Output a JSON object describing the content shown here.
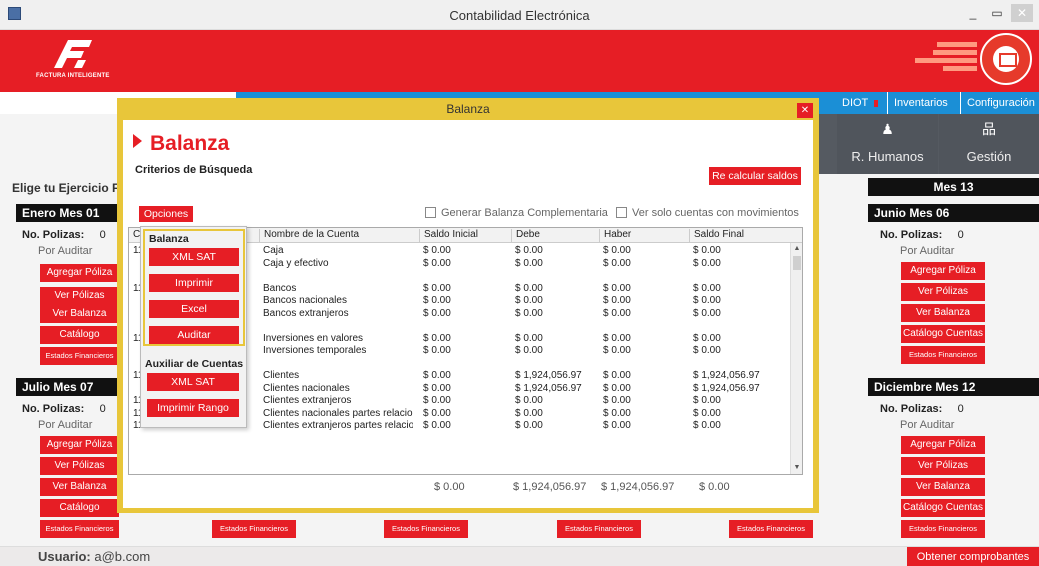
{
  "window": {
    "title": "Contabilidad Electrónica",
    "minimize": "_",
    "maximize": "▭",
    "close": "✕"
  },
  "brand": {
    "name": "FACTURA INTELIGENTE"
  },
  "nav": {
    "diot": "DIOT",
    "inventarios": "Inventarios",
    "configuracion": "Configuración"
  },
  "tiles": {
    "rhumanos": "R. Humanos",
    "gestion": "Gestión"
  },
  "dashboard": {
    "choose_year": "Elige tu Ejercicio F",
    "mes13": "Mes 13",
    "months": {
      "enero": "Enero Mes 01",
      "junio": "Junio Mes 06",
      "julio": "Julio Mes 07",
      "diciembre": "Diciembre Mes 12"
    },
    "polizas_label": "No. Polizas:",
    "polizas_count": "0",
    "por_auditar": "Por Auditar",
    "buttons": {
      "agregar": "Agregar Póliza",
      "ver_polizas": "Ver Pólizas",
      "ver_balanza": "Ver Balanza",
      "catalogo": "Catálogo Cuentas",
      "estados": "Estados Financieros"
    }
  },
  "statusbar": {
    "user_label": "Usuario:",
    "user": "a@b.com",
    "get_button": "Obtener comprobantes"
  },
  "modal": {
    "title": "Balanza",
    "heading": "Balanza",
    "criteria": "Criterios de Búsqueda",
    "recalc": "Re calcular saldos",
    "opciones": "Opciones",
    "complementaria": "Generar Balanza Complementaria",
    "solo_movimientos": "Ver solo cuentas con movimientos",
    "columns": [
      "C",
      "Nombre de la Cuenta",
      "Saldo Inicial",
      "Debe",
      "Haber",
      "Saldo Final"
    ],
    "rows": [
      {
        "code": "11",
        "name": "Caja",
        "ini": "$ 0.00",
        "debe": "$ 0.00",
        "haber": "$ 0.00",
        "fin": "$ 0.00"
      },
      {
        "code": "",
        "name": "Caja y efectivo",
        "ini": "$ 0.00",
        "debe": "$ 0.00",
        "haber": "$ 0.00",
        "fin": "$ 0.00"
      },
      {
        "code": "",
        "name": "",
        "ini": "",
        "debe": "",
        "haber": "",
        "fin": ""
      },
      {
        "code": "11",
        "name": "Bancos",
        "ini": "$ 0.00",
        "debe": "$ 0.00",
        "haber": "$ 0.00",
        "fin": "$ 0.00"
      },
      {
        "code": "",
        "name": "Bancos nacionales",
        "ini": "$ 0.00",
        "debe": "$ 0.00",
        "haber": "$ 0.00",
        "fin": "$ 0.00"
      },
      {
        "code": "",
        "name": "Bancos extranjeros",
        "ini": "$ 0.00",
        "debe": "$ 0.00",
        "haber": "$ 0.00",
        "fin": "$ 0.00"
      },
      {
        "code": "",
        "name": "",
        "ini": "",
        "debe": "",
        "haber": "",
        "fin": ""
      },
      {
        "code": "11",
        "name": "Inversiones en valores",
        "ini": "$ 0.00",
        "debe": "$ 0.00",
        "haber": "$ 0.00",
        "fin": "$ 0.00"
      },
      {
        "code": "",
        "name": "Inversiones temporales",
        "ini": "$ 0.00",
        "debe": "$ 0.00",
        "haber": "$ 0.00",
        "fin": "$ 0.00"
      },
      {
        "code": "",
        "name": "",
        "ini": "",
        "debe": "",
        "haber": "",
        "fin": ""
      },
      {
        "code": "11",
        "name": "Clientes",
        "ini": "$ 0.00",
        "debe": "$ 1,924,056.97",
        "haber": "$ 0.00",
        "fin": "$ 1,924,056.97"
      },
      {
        "code": "",
        "name": "Clientes nacionales",
        "ini": "$ 0.00",
        "debe": "$ 1,924,056.97",
        "haber": "$ 0.00",
        "fin": "$ 1,924,056.97"
      },
      {
        "code": "1150-002-000",
        "name": "Clientes extranjeros",
        "ini": "$ 0.00",
        "debe": "$ 0.00",
        "haber": "$ 0.00",
        "fin": "$ 0.00"
      },
      {
        "code": "1150-003-000",
        "name": "Clientes nacionales partes relacion...",
        "ini": "$ 0.00",
        "debe": "$ 0.00",
        "haber": "$ 0.00",
        "fin": "$ 0.00"
      },
      {
        "code": "1150-004-000",
        "name": "Clientes extranjeros partes relacion...",
        "ini": "$ 0.00",
        "debe": "$ 0.00",
        "haber": "$ 0.00",
        "fin": "$ 0.00"
      }
    ],
    "totals": {
      "ini": "$ 0.00",
      "debe": "$ 1,924,056.97",
      "haber": "$ 1,924,056.97",
      "fin": "$ 0.00"
    }
  },
  "dropdown": {
    "balanza_label": "Balanza",
    "xml_sat": "XML SAT",
    "imprimir": "Imprimir",
    "excel": "Excel",
    "auditar": "Auditar",
    "auxiliar_label": "Auxiliar de Cuentas",
    "aux_xml_sat": "XML SAT",
    "imprimir_rango": "Imprimir Rango"
  }
}
